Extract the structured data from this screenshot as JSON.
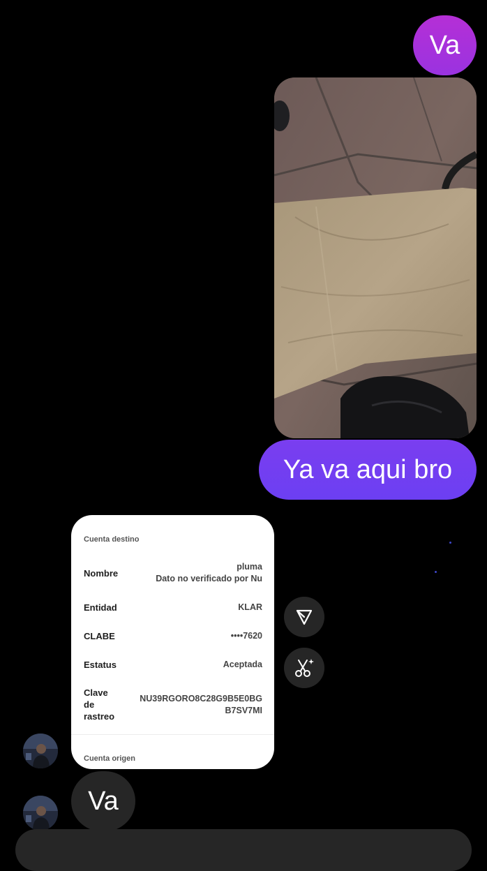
{
  "messages": {
    "outgoing_va": "Va",
    "outgoing_yava": "Ya va aqui bro",
    "incoming_va": "Va"
  },
  "receipt": {
    "section_destino": "Cuenta destino",
    "nombre_label": "Nombre",
    "nombre_value": "pluma",
    "nombre_note": "Dato no verificado por Nu",
    "entidad_label": "Entidad",
    "entidad_value": "KLAR",
    "clabe_label": "CLABE",
    "clabe_value": "••••7620",
    "estatus_label": "Estatus",
    "estatus_value": "Aceptada",
    "clave_label_1": "Clave",
    "clave_label_2": "de",
    "clave_label_3": "rastreo",
    "clave_value_1": "NU39RGORO8C28G9B5E0BG",
    "clave_value_2": "B7SV7MI",
    "section_origen": "Cuenta origen"
  },
  "icons": {
    "share": "paper-plane-icon",
    "cutout": "scissors-sparkle-icon",
    "photo": "brown-paper-bag-photo"
  },
  "colors": {
    "background": "#000000",
    "outgoing_top": "#a62fd8",
    "outgoing_bottom": "#7c3cf1",
    "incoming_bubble": "#262626",
    "text": "#ffffff"
  }
}
